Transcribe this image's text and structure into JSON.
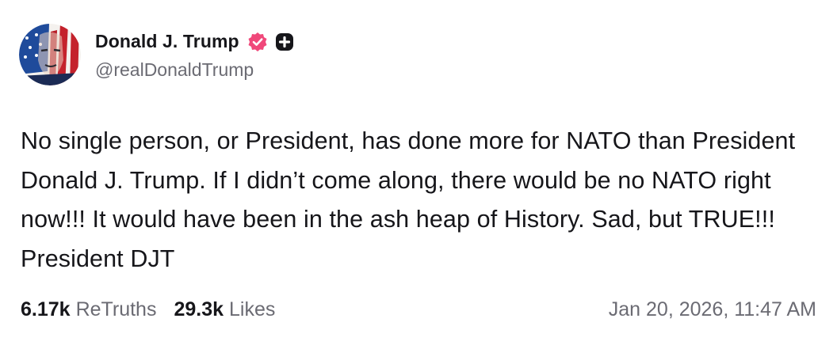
{
  "author": {
    "display_name": "Donald J. Trump",
    "handle": "@realDonaldTrump",
    "verified_icon": "verified-badge-icon",
    "plus_icon": "plus-badge-icon",
    "verified_color": "#f0487a",
    "plus_color": "#16161a"
  },
  "post": {
    "text": "No single person, or President, has done more for NATO than President Donald J. Trump. If I didn’t come along, there would be no NATO right now!!! It would have been in the ash heap of History. Sad, but TRUE!!! President DJT",
    "retruths_count": "6.17k",
    "retruths_label": "ReTruths",
    "likes_count": "29.3k",
    "likes_label": "Likes",
    "timestamp": "Jan 20, 2026, 11:47 AM"
  },
  "colors": {
    "text": "#16161a",
    "muted": "#6b6b73",
    "background": "#ffffff"
  }
}
